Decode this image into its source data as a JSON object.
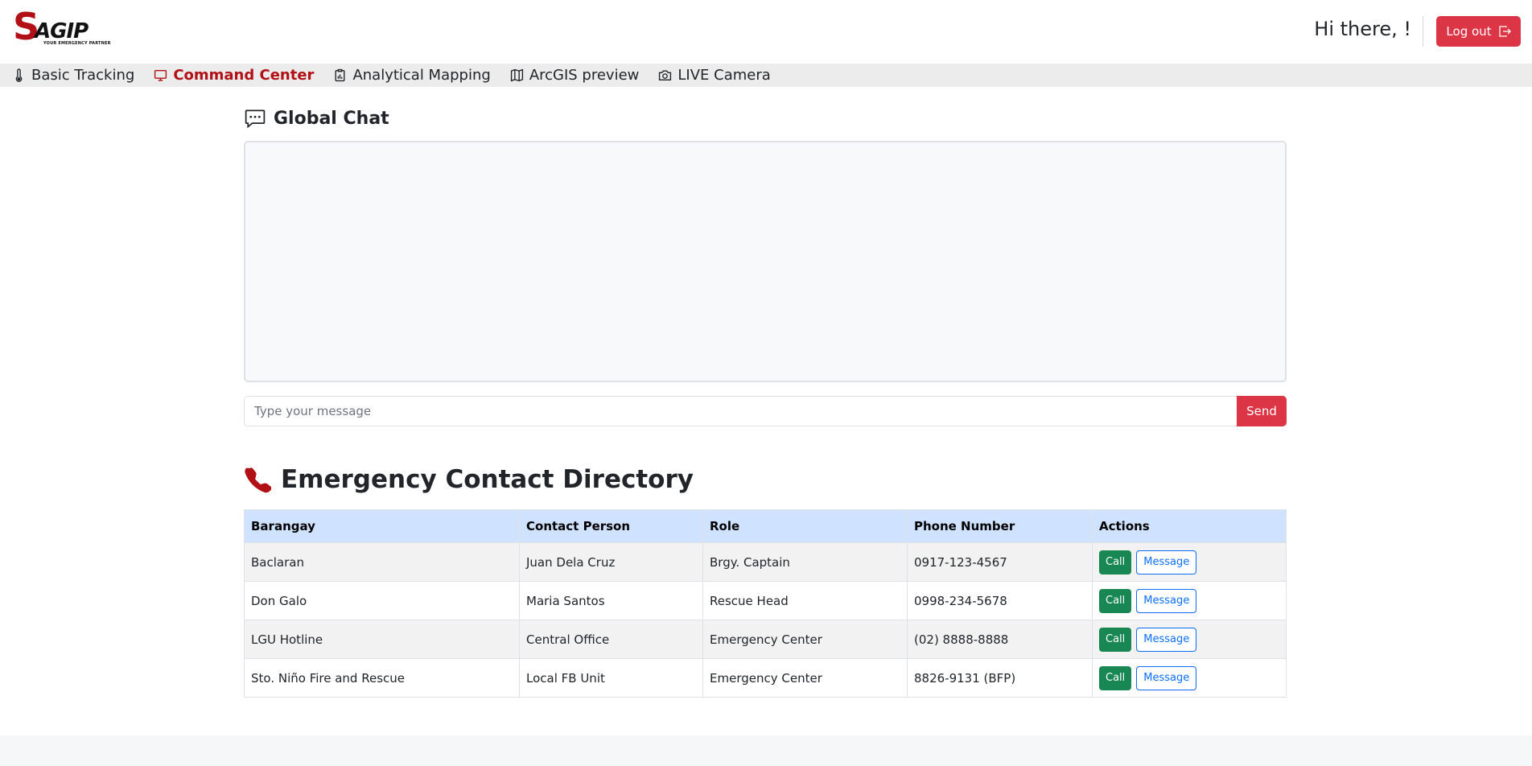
{
  "brand": {
    "logo_letter": "S",
    "logo_rest": "AGIP",
    "tagline": "YOUR EMERGENCY PARTNER"
  },
  "header": {
    "greeting": "Hi there, !",
    "logout_label": "Log out"
  },
  "nav": {
    "items": [
      {
        "label": "Basic Tracking",
        "icon": "thermometer-icon",
        "active": false
      },
      {
        "label": "Command Center",
        "icon": "monitor-icon",
        "active": true
      },
      {
        "label": "Analytical Mapping",
        "icon": "clipboard-chart-icon",
        "active": false
      },
      {
        "label": "ArcGIS preview",
        "icon": "map-icon",
        "active": false
      },
      {
        "label": "LIVE Camera",
        "icon": "camera-icon",
        "active": false
      }
    ]
  },
  "chat": {
    "title": "Global Chat",
    "icon": "chat-dots-icon",
    "input_placeholder": "Type your message",
    "send_label": "Send"
  },
  "directory": {
    "title": "Emergency Contact Directory",
    "icon": "telephone-icon",
    "columns": [
      "Barangay",
      "Contact Person",
      "Role",
      "Phone Number",
      "Actions"
    ],
    "rows": [
      {
        "barangay": "Baclaran",
        "contact": "Juan Dela Cruz",
        "role": "Brgy. Captain",
        "phone": "0917-123-4567"
      },
      {
        "barangay": "Don Galo",
        "contact": "Maria Santos",
        "role": "Rescue Head",
        "phone": "0998-234-5678"
      },
      {
        "barangay": "LGU Hotline",
        "contact": "Central Office",
        "role": "Emergency Center",
        "phone": "(02) 8888-8888"
      },
      {
        "barangay": "Sto. Niño Fire and Rescue",
        "contact": "Local FB Unit",
        "role": "Emergency Center",
        "phone": "8826-9131 (BFP)"
      }
    ],
    "call_label": "Call",
    "message_label": "Message"
  },
  "colors": {
    "brand_red": "#b01016",
    "danger": "#dc3545",
    "success": "#198754",
    "primary": "#0d6efd",
    "table_header": "#cfe2ff"
  }
}
